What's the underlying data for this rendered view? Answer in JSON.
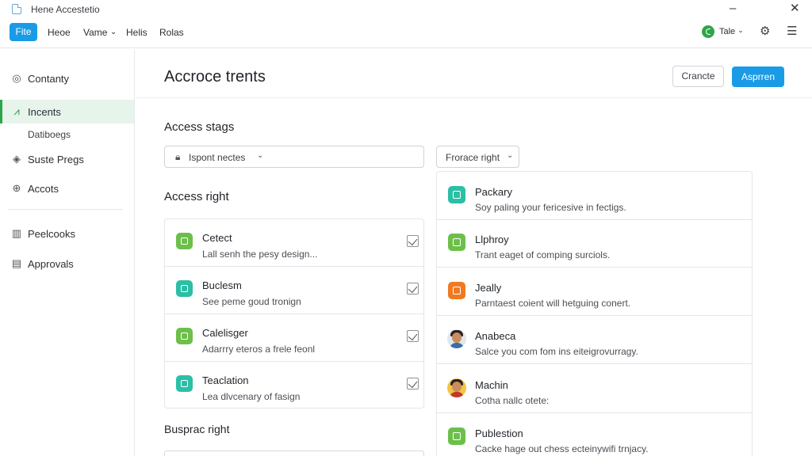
{
  "window": {
    "title": "Hene Accestetio",
    "minimize_glyph": "–",
    "close_glyph": "✕"
  },
  "menu": {
    "file_label": "Fite",
    "items": [
      "Heoe",
      "Vame",
      "Helis",
      "Rolas"
    ],
    "vame_chevron": "⌄"
  },
  "toolbar_right": {
    "user_label": "Tale",
    "user_chevron": "⌄",
    "icons": [
      "settings-icon",
      "hamburger-menu-icon"
    ]
  },
  "sidebar": {
    "items": [
      {
        "label": "Contanty",
        "icon": "contact-icon"
      },
      {
        "label": "Incents",
        "icon": "chart-icon",
        "active": true
      },
      {
        "label": "Suste Pregs",
        "icon": "diamond-icon"
      },
      {
        "label": "Accots",
        "icon": "account-icon"
      },
      {
        "label": "Peelcooks",
        "icon": "book-icon"
      },
      {
        "label": "Approvals",
        "icon": "table-icon"
      }
    ],
    "subitem": "Datiboegs"
  },
  "page": {
    "title": "Accroce trents",
    "cancel_label": "Crancte",
    "approve_label": "Asprren"
  },
  "access_stags": {
    "title": "Access stags",
    "select_value": "Ispont nectes",
    "second_select": "Frorace right"
  },
  "access_right": {
    "title": "Access right",
    "rows": [
      {
        "title": "Cetect",
        "desc": "Lall senh the pesy design...",
        "color": "#6cc04a",
        "checked": true
      },
      {
        "title": "Buclesm",
        "desc": "See peme goud tronign",
        "color": "#2bbfa6",
        "checked": true
      },
      {
        "title": "Calelisger",
        "desc": "Adarrry eteros a frele feonl",
        "color": "#6cc04a",
        "checked": true
      },
      {
        "title": "Teaclation",
        "desc": "Lea dlvcenary of fasign",
        "color": "#2bbfa6",
        "checked": true
      }
    ]
  },
  "bottom_section": {
    "title": "Busprac right"
  },
  "right_list": {
    "rows": [
      {
        "title": "Packary",
        "desc": "Soy paling your fericesive in fectigs.",
        "kind": "icon",
        "color": "#2bbfa6"
      },
      {
        "title": "Llphroy",
        "desc": "Trant eaget of comping surciols.",
        "kind": "icon",
        "color": "#6cc04a"
      },
      {
        "title": "Jeally",
        "desc": "Parntaest coient will hetguing conert.",
        "kind": "icon",
        "color": "#f07a22"
      },
      {
        "title": "Anabeca",
        "desc": "Salce you com fom ins eiteigrovurragy.",
        "kind": "avatar",
        "color": "#3a6ea5"
      },
      {
        "title": "Machin",
        "desc": "Cotha nallc otete:",
        "kind": "avatar",
        "color": "#e9a92a"
      },
      {
        "title": "Publestion",
        "desc": "Cacke hage out chess ecteinywifi trnjacy.",
        "kind": "icon",
        "color": "#6cc04a"
      }
    ]
  },
  "colors": {
    "accent": "#1a9be6",
    "active_nav": "#e7f4ec",
    "green": "#2fa54a"
  }
}
